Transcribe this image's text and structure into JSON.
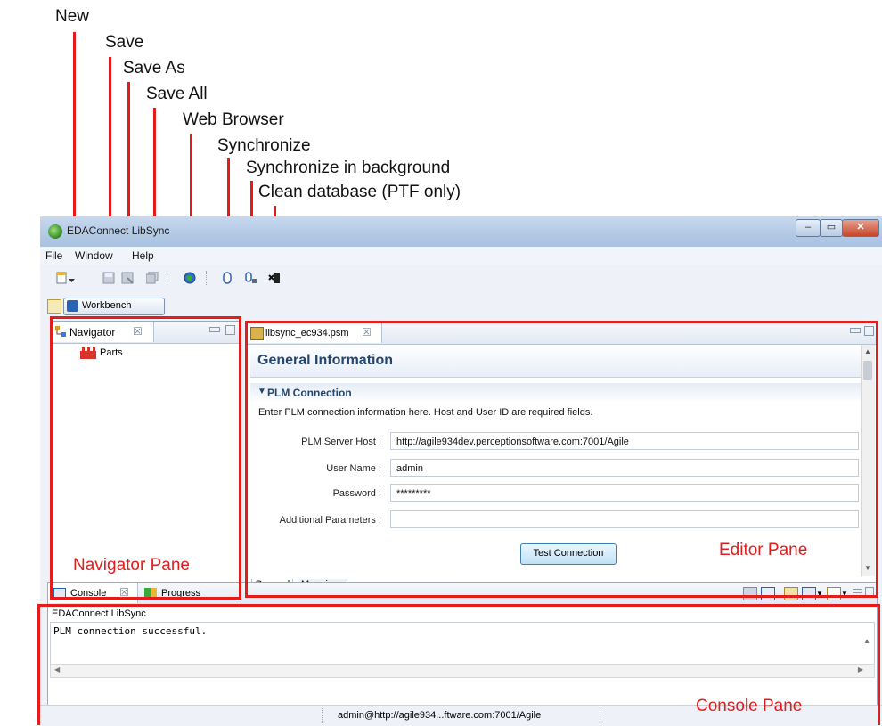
{
  "callouts": [
    "New",
    "Save",
    "Save As",
    "Save All",
    "Web Browser",
    "Synchronize",
    "Synchronize in background",
    "Clean database (PTF only)"
  ],
  "window": {
    "title": "EDAConnect LibSync",
    "controls": {
      "minimize": "–",
      "maximize": "▭",
      "close": "✕"
    }
  },
  "menubar": [
    "File",
    "Window",
    "Help"
  ],
  "toolbar": {
    "icons": [
      "new-icon",
      "save-icon",
      "save-as-icon",
      "save-all-icon",
      "web-browser-icon",
      "synchronize-icon",
      "synchronize-background-icon",
      "clean-database-icon"
    ]
  },
  "perspective": {
    "label": "Workbench"
  },
  "navigator": {
    "tab_label": "Navigator",
    "close_glyph": "☒",
    "items": [
      {
        "label": "Parts",
        "icon": "parts-icon"
      }
    ],
    "pane_label": "Navigator Pane"
  },
  "editor": {
    "tab_label": "libsync_ec934.psm",
    "close_glyph": "☒",
    "form_title": "General Information",
    "section_title": "PLM Connection",
    "section_desc": "Enter PLM connection information here. Host and User ID are required fields.",
    "fields": [
      {
        "label": "PLM Server Host :",
        "value": "http://agile934dev.perceptionsoftware.com:7001/Agile"
      },
      {
        "label": "User Name :",
        "value": "admin"
      },
      {
        "label": "Password :",
        "value": "*********"
      },
      {
        "label": "Additional Parameters :",
        "value": ""
      }
    ],
    "test_button": "Test Connection",
    "bottom_tabs": [
      "General",
      "Mappings"
    ],
    "pane_label": "Editor Pane"
  },
  "console": {
    "tabs": [
      "Console",
      "Progress"
    ],
    "close_glyph": "☒",
    "header": "EDAConnect LibSync",
    "lines": [
      "PLM connection successful."
    ],
    "pane_label": "Console Pane"
  },
  "statusbar": {
    "text": "admin@http://agile934...ftware.com:7001/Agile"
  }
}
